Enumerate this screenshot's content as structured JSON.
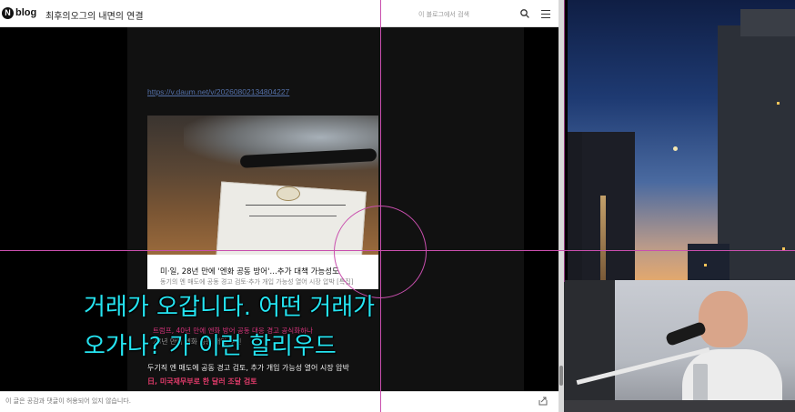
{
  "blog": {
    "logo_letter": "N",
    "logo_word": "blog",
    "blog_name": "최후의오그의 내면의 연결",
    "search_placeholder": "이 블로그에서 검색",
    "post_link": "https://v.daum.net/v/20260802134804227",
    "card_title": "미·일, 28년 만에 '엔화 공동 방어'…추가 대책 가능성도",
    "card_desc": "동기의 엔 매도에 공동 경고 검토·추가 개입 가능성 열어 시장 압박 [특집]",
    "partial_line_1": "트럼프, 40년 만에 엔화 방어 공동 대응 경고 공식화하나",
    "partial_line_2": "28년 만에 엔화 공동 개입 추진",
    "body_line": "두기직 엔 매도에 공동 경고 검토, 추가 개입 가능성 열어 시장 압박",
    "red_line": "日, 미국재무부로 한 달러 조달 검토",
    "footer_note": "이 글은 공감과 댓글이 허용되어 있지 않습니다."
  },
  "subtitles": {
    "line1": "거래가 오갑니다. 어떤 거래가",
    "line2": "오가나? 가 이런 할리우드"
  },
  "icons": {
    "search": "search-icon",
    "menu": "menu-icon",
    "share": "share-icon"
  },
  "colors": {
    "subtitle": "#25e4f1",
    "crosshair": "#c94fae",
    "link": "#5470a8",
    "accent_red": "#e03b6a"
  }
}
